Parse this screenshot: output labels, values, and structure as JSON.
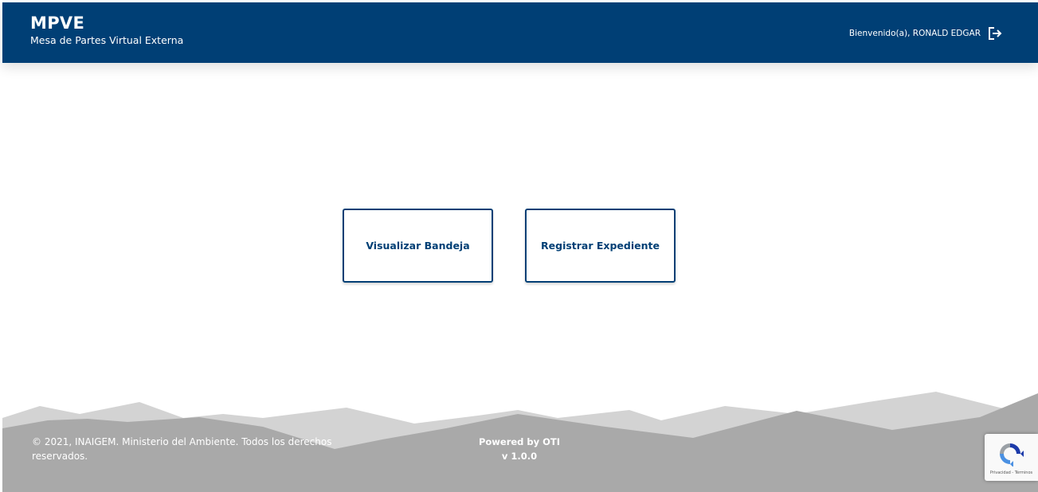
{
  "header": {
    "title": "MPVE",
    "subtitle": "Mesa de Partes Virtual Externa",
    "welcome": "Bienvenido(a), RONALD EDGAR",
    "logout_icon": "logout-icon"
  },
  "actions": {
    "visualizar_label": "Visualizar Bandeja",
    "registrar_label": "Registrar Expediente"
  },
  "footer": {
    "copyright": "© 2021, INAIGEM. Ministerio del Ambiente. Todos los derechos reservados.",
    "powered": "Powered by OTI",
    "version": "v 1.0.0"
  },
  "recaptcha": {
    "links": "Privacidad - Términos",
    "icon": "recaptcha-icon"
  },
  "colors": {
    "brand": "#003f75",
    "footer_dark": "#a9a9a9",
    "footer_light": "#d3d3d3"
  }
}
